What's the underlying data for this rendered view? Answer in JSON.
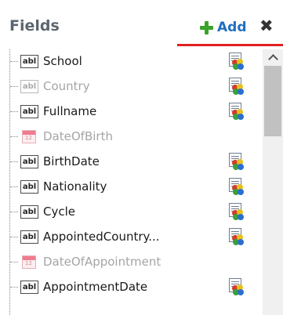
{
  "header": {
    "title": "Fields",
    "add_label": "Add",
    "close_glyph": "✖"
  },
  "fields": [
    {
      "label": "School",
      "type": "text",
      "enabled": true,
      "has_action": true
    },
    {
      "label": "Country",
      "type": "text",
      "enabled": false,
      "has_action": true
    },
    {
      "label": "Fullname",
      "type": "text",
      "enabled": true,
      "has_action": true
    },
    {
      "label": "DateOfBirth",
      "type": "date",
      "enabled": false,
      "has_action": false
    },
    {
      "label": "BirthDate",
      "type": "text",
      "enabled": true,
      "has_action": true
    },
    {
      "label": "Nationality",
      "type": "text",
      "enabled": true,
      "has_action": true
    },
    {
      "label": "Cycle",
      "type": "text",
      "enabled": true,
      "has_action": true
    },
    {
      "label": "AppointedCountry...",
      "type": "text",
      "enabled": true,
      "has_action": true
    },
    {
      "label": "DateOfAppointment",
      "type": "date",
      "enabled": false,
      "has_action": false
    },
    {
      "label": "AppointmentDate",
      "type": "text",
      "enabled": true,
      "has_action": true
    }
  ],
  "icons": {
    "text_field": "text-field-icon",
    "text_field_glyph": "abl",
    "date_field": "calendar-icon",
    "row_action": "report-icon",
    "add": "plus-icon",
    "close": "close-icon"
  },
  "colors": {
    "title": "#5c6670",
    "add_plus": "#3aa32a",
    "add_label": "#1f6fc0",
    "active_underline": "#e02020",
    "disabled_text": "#a5a5a5"
  }
}
